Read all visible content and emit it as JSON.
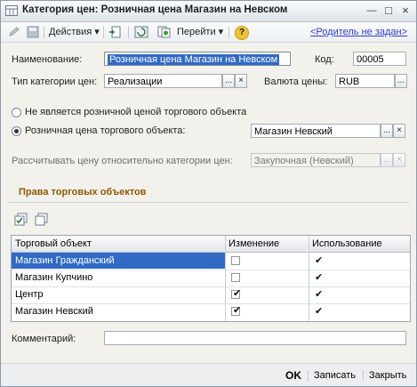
{
  "window": {
    "title": "Категория цен: Розничная цена Магазин на Невском"
  },
  "toolbar": {
    "actions_label": "Действия",
    "goto_label": "Перейти",
    "help_label": "?",
    "parent_link": "<Родитель не задан>"
  },
  "form": {
    "name_label": "Наименование:",
    "name_value": "Розничная цена Магазин на Невском",
    "code_label": "Код:",
    "code_value": "00005",
    "type_label": "Тип категории цен:",
    "type_value": "Реализации",
    "currency_label": "Валюта цены:",
    "currency_value": "RUB",
    "radio_not_retail": "Не является розничной ценой торгового объекта",
    "radio_retail": "Розничная цена торгового объекта:",
    "retail_object_value": "Магазин Невский",
    "relative_label": "Рассчитывать цену относительно категории цен:",
    "relative_value": "Закупочная (Невский)",
    "select_btn": "...",
    "clear_btn": "×"
  },
  "rights": {
    "section_title": "Права торговых объектов",
    "columns": [
      "Торговый объект",
      "Изменение",
      "Использование"
    ],
    "rows": [
      {
        "name": "Магазин Гражданский",
        "change": false,
        "use": true
      },
      {
        "name": "Магазин Купчино",
        "change": false,
        "use": true
      },
      {
        "name": "Центр",
        "change": true,
        "use": true
      },
      {
        "name": "Магазин Невский",
        "change": true,
        "use": true
      }
    ]
  },
  "comment": {
    "label": "Комментарий:",
    "value": ""
  },
  "buttons": {
    "ok": "OK",
    "save": "Записать",
    "close": "Закрыть"
  },
  "colors": {
    "selection": "#316ac5",
    "section_title": "#8b5a00",
    "link": "#2f3fd0"
  }
}
